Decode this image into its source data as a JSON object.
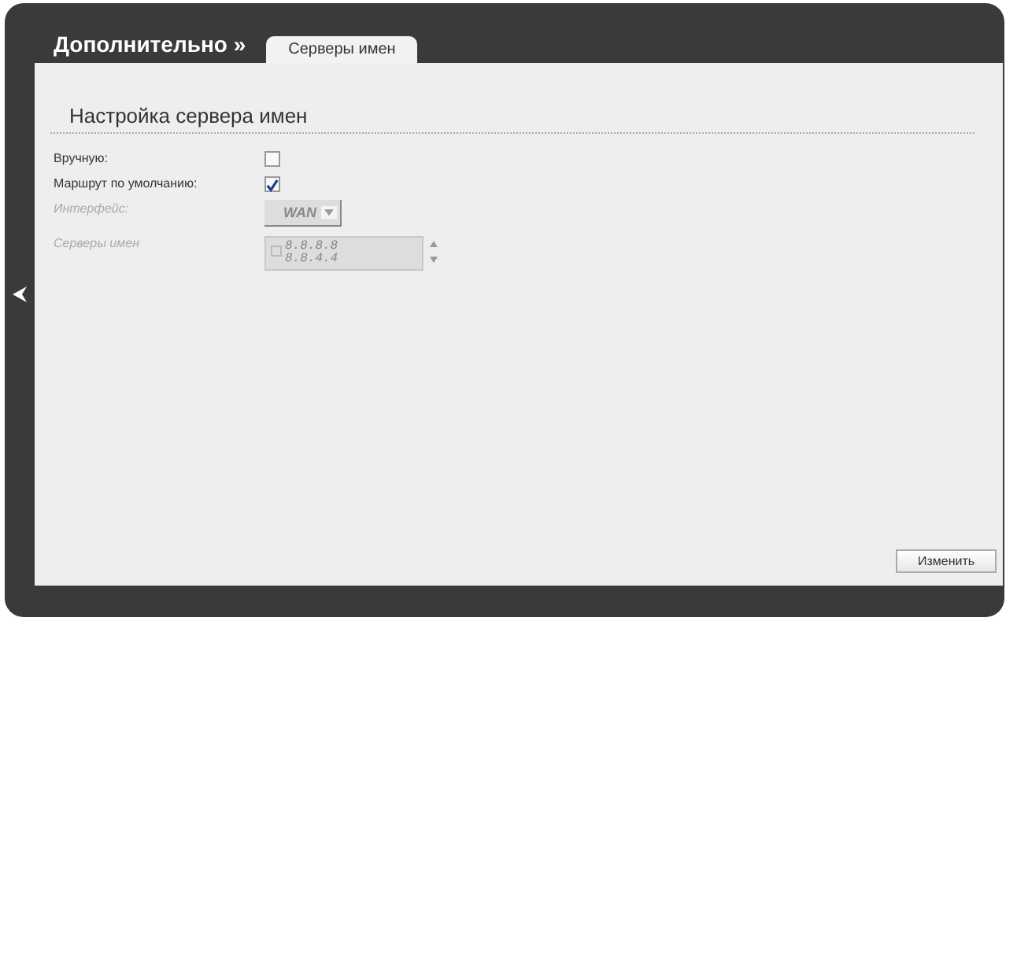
{
  "header": {
    "title": "Дополнительно »",
    "tabs": [
      {
        "label": "Серверы имен",
        "selected": true
      }
    ]
  },
  "section": {
    "title": "Настройка сервера имен"
  },
  "fields": [
    {
      "kind": "checkbox",
      "label": "Вручную:",
      "checked": false,
      "disabled": false
    },
    {
      "kind": "checkbox",
      "label": "Маршрут по умолчанию:",
      "checked": true,
      "disabled": false
    },
    {
      "kind": "select",
      "label": "Интерфейс:",
      "value": "WAN",
      "disabled": true
    },
    {
      "kind": "textarea",
      "label": "Серверы имен",
      "lines": [
        "8.8.8.8",
        "8.8.4.4"
      ],
      "disabled": true
    }
  ],
  "buttons": [
    {
      "label": "Изменить"
    }
  ]
}
